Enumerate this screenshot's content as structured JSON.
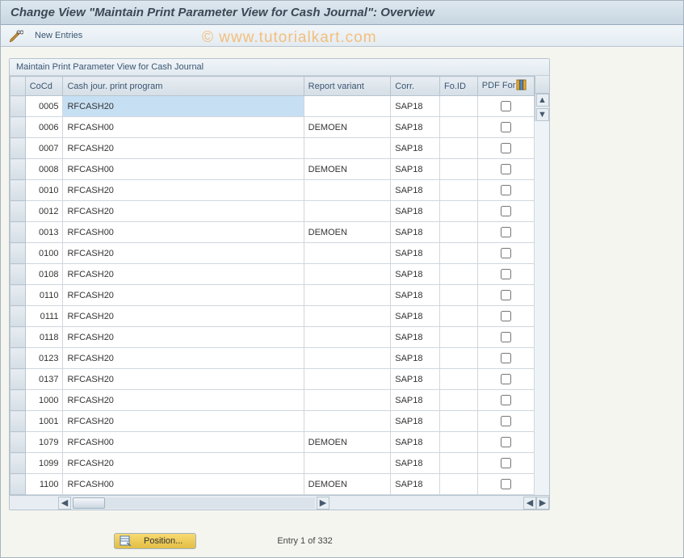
{
  "title": "Change View \"Maintain Print Parameter View for Cash Journal\": Overview",
  "toolbar": {
    "new_entries": "New Entries"
  },
  "panel": {
    "title": "Maintain Print Parameter View for Cash Journal"
  },
  "columns": {
    "cocd": "CoCd",
    "prog": "Cash jour. print program",
    "rv": "Report variant",
    "corr": "Corr.",
    "foid": "Fo.ID",
    "pdf": "PDF Form"
  },
  "rows": [
    {
      "cocd": "0005",
      "prog": "RFCASH20",
      "rv": "",
      "corr": "SAP18",
      "foid": "",
      "pdf": false,
      "hl": true
    },
    {
      "cocd": "0006",
      "prog": "RFCASH00",
      "rv": "DEMOEN",
      "corr": "SAP18",
      "foid": "",
      "pdf": false
    },
    {
      "cocd": "0007",
      "prog": "RFCASH20",
      "rv": "",
      "corr": "SAP18",
      "foid": "",
      "pdf": false
    },
    {
      "cocd": "0008",
      "prog": "RFCASH00",
      "rv": "DEMOEN",
      "corr": "SAP18",
      "foid": "",
      "pdf": false
    },
    {
      "cocd": "0010",
      "prog": "RFCASH20",
      "rv": "",
      "corr": "SAP18",
      "foid": "",
      "pdf": false
    },
    {
      "cocd": "0012",
      "prog": "RFCASH20",
      "rv": "",
      "corr": "SAP18",
      "foid": "",
      "pdf": false
    },
    {
      "cocd": "0013",
      "prog": "RFCASH00",
      "rv": "DEMOEN",
      "corr": "SAP18",
      "foid": "",
      "pdf": false
    },
    {
      "cocd": "0100",
      "prog": "RFCASH20",
      "rv": "",
      "corr": "SAP18",
      "foid": "",
      "pdf": false
    },
    {
      "cocd": "0108",
      "prog": "RFCASH20",
      "rv": "",
      "corr": "SAP18",
      "foid": "",
      "pdf": false
    },
    {
      "cocd": "0110",
      "prog": "RFCASH20",
      "rv": "",
      "corr": "SAP18",
      "foid": "",
      "pdf": false
    },
    {
      "cocd": "0111",
      "prog": "RFCASH20",
      "rv": "",
      "corr": "SAP18",
      "foid": "",
      "pdf": false
    },
    {
      "cocd": "0118",
      "prog": "RFCASH20",
      "rv": "",
      "corr": "SAP18",
      "foid": "",
      "pdf": false
    },
    {
      "cocd": "0123",
      "prog": "RFCASH20",
      "rv": "",
      "corr": "SAP18",
      "foid": "",
      "pdf": false
    },
    {
      "cocd": "0137",
      "prog": "RFCASH20",
      "rv": "",
      "corr": "SAP18",
      "foid": "",
      "pdf": false
    },
    {
      "cocd": "1000",
      "prog": "RFCASH20",
      "rv": "",
      "corr": "SAP18",
      "foid": "",
      "pdf": false
    },
    {
      "cocd": "1001",
      "prog": "RFCASH20",
      "rv": "",
      "corr": "SAP18",
      "foid": "",
      "pdf": false
    },
    {
      "cocd": "1079",
      "prog": "RFCASH00",
      "rv": "DEMOEN",
      "corr": "SAP18",
      "foid": "",
      "pdf": false
    },
    {
      "cocd": "1099",
      "prog": "RFCASH20",
      "rv": "",
      "corr": "SAP18",
      "foid": "",
      "pdf": false
    },
    {
      "cocd": "1100",
      "prog": "RFCASH00",
      "rv": "DEMOEN",
      "corr": "SAP18",
      "foid": "",
      "pdf": false
    }
  ],
  "footer": {
    "position_btn": "Position...",
    "entry_text": "Entry 1 of 332"
  },
  "watermark": "© www.tutorialkart.com",
  "icons": {
    "pencil": "pencil-icon",
    "colsel": "column-select-icon"
  }
}
